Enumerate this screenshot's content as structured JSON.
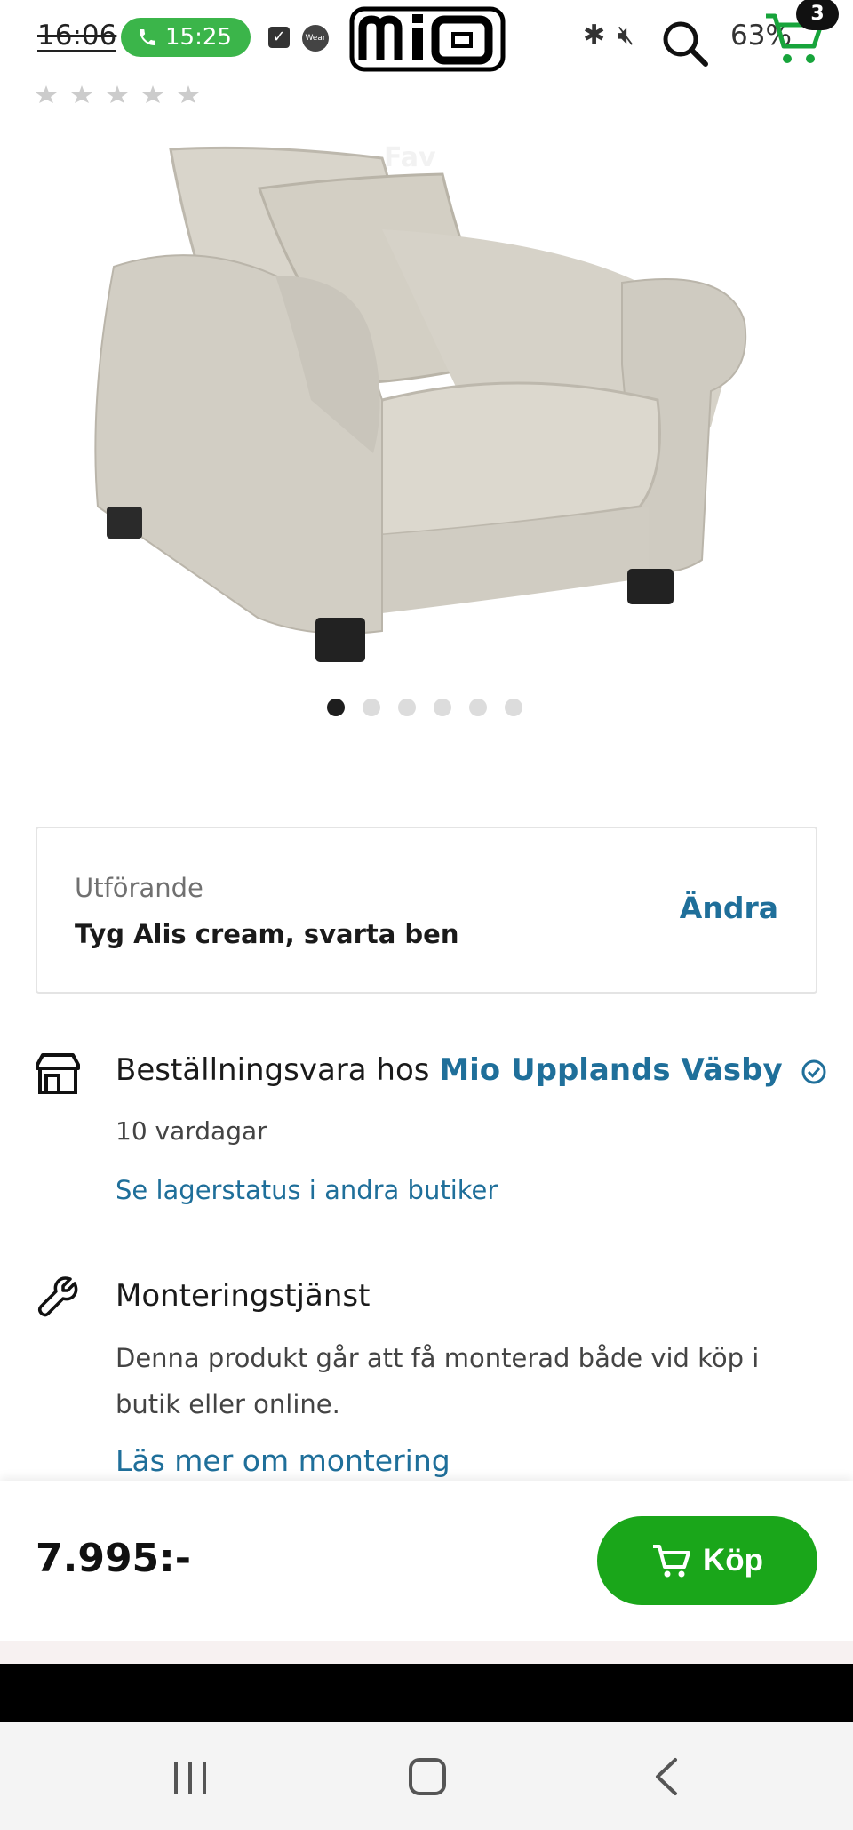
{
  "status_bar": {
    "time_old": "16:06",
    "call_time": "15:25",
    "wear_label": "Wear",
    "battery": "63%",
    "cart_count": "3"
  },
  "brand": {
    "logo_text": "mio"
  },
  "product": {
    "image_overlay_text": "Fav",
    "image_count": 6,
    "active_image_index": 0
  },
  "variant": {
    "label": "Utförande",
    "value": "Tyg Alis cream, svarta ben",
    "change_label": "Ändra"
  },
  "availability": {
    "prefix": "Beställningsvara hos",
    "store": "Mio Upplands Väsby",
    "delivery": "10 vardagar",
    "stock_link": "Se lagerstatus i andra butiker"
  },
  "assembly": {
    "title": "Monteringstjänst",
    "description": "Denna produkt går att få monterad både vid köp i butik eller online.",
    "link": "Läs mer om montering"
  },
  "buy_bar": {
    "price": "7.995:-",
    "buy_label": "Köp"
  },
  "colors": {
    "accent_blue": "#1f6f9a",
    "buy_green": "#1aa61a",
    "call_green": "#3bb54a"
  }
}
